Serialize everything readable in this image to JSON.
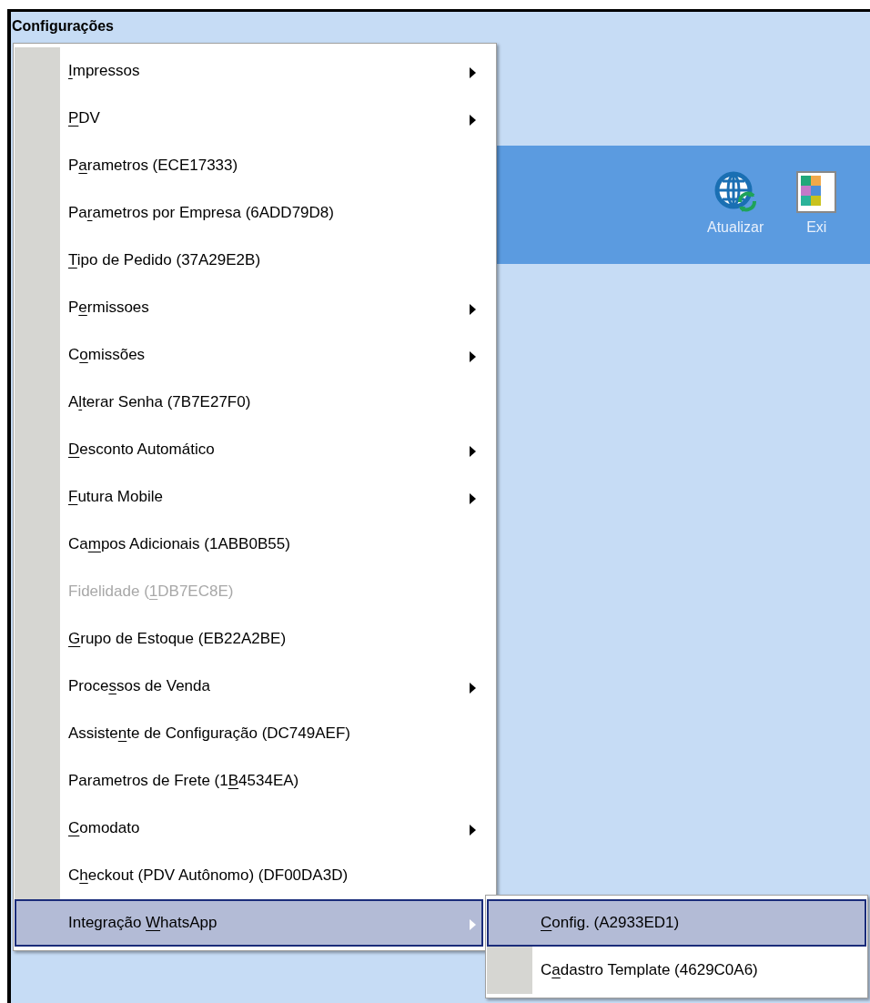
{
  "window": {
    "title": "Configurações"
  },
  "toolbar": [
    {
      "label": "Atualizar",
      "kind": "globe"
    },
    {
      "label": "Exi",
      "kind": "grid"
    }
  ],
  "menu": [
    {
      "access_key": "I",
      "label_after": "mpressos",
      "submenu": true,
      "disabled": false,
      "selected": false
    },
    {
      "access_key": "P",
      "label_after": "DV",
      "submenu": true,
      "disabled": false,
      "selected": false
    },
    {
      "label_before": "P",
      "access_key": "a",
      "label_after": "rametros (ECE17333)",
      "submenu": false,
      "disabled": false,
      "selected": false
    },
    {
      "label_before": "Pa",
      "access_key": "r",
      "label_after": "ametros por Empresa (6ADD79D8)",
      "submenu": false,
      "disabled": false,
      "selected": false
    },
    {
      "access_key": "T",
      "label_after": "ipo de Pedido (37A29E2B)",
      "submenu": false,
      "disabled": false,
      "selected": false
    },
    {
      "label_before": "P",
      "access_key": "e",
      "label_after": "rmissoes",
      "submenu": true,
      "disabled": false,
      "selected": false
    },
    {
      "label_before": "C",
      "access_key": "o",
      "label_after": "missões",
      "submenu": true,
      "disabled": false,
      "selected": false
    },
    {
      "label_before": "A",
      "access_key": "l",
      "label_after": "terar Senha (7B7E27F0)",
      "submenu": false,
      "disabled": false,
      "selected": false
    },
    {
      "access_key": "D",
      "label_after": "esconto Automático",
      "submenu": true,
      "disabled": false,
      "selected": false
    },
    {
      "access_key": "F",
      "label_after": "utura Mobile",
      "submenu": true,
      "disabled": false,
      "selected": false
    },
    {
      "label_before": "Ca",
      "access_key": "m",
      "label_after": "pos Adicionais (1ABB0B55)",
      "submenu": false,
      "disabled": false,
      "selected": false
    },
    {
      "label_before": "Fidelidade (",
      "access_key": "1",
      "label_after": "DB7EC8E)",
      "submenu": false,
      "disabled": true,
      "selected": false
    },
    {
      "access_key": "G",
      "label_after": "rupo de Estoque (EB22A2BE)",
      "submenu": false,
      "disabled": false,
      "selected": false
    },
    {
      "label_before": "Proce",
      "access_key": "s",
      "label_after": "sos de Venda",
      "submenu": true,
      "disabled": false,
      "selected": false
    },
    {
      "label_before": "Assiste",
      "access_key": "n",
      "label_after": "te de Configuração (DC749AEF)",
      "submenu": false,
      "disabled": false,
      "selected": false
    },
    {
      "label_before": "Parametros de Frete (1",
      "access_key": "B",
      "label_after": "4534EA)",
      "submenu": false,
      "disabled": false,
      "selected": false
    },
    {
      "access_key": "C",
      "label_after": "omodato",
      "submenu": true,
      "disabled": false,
      "selected": false
    },
    {
      "label_before": "C",
      "access_key": "h",
      "label_after": "eckout (PDV Autônomo) (DF00DA3D)",
      "submenu": false,
      "disabled": false,
      "selected": false
    },
    {
      "label_before": "Integração ",
      "access_key": "W",
      "label_after": "hatsApp",
      "submenu": true,
      "disabled": false,
      "selected": true
    }
  ],
  "submenu": [
    {
      "access_key": "C",
      "label_after": "onfig. (A2933ED1)",
      "selected": true
    },
    {
      "label_before": "C",
      "access_key": "a",
      "label_after": "dastro Template (4629C0A6)",
      "selected": false
    }
  ]
}
